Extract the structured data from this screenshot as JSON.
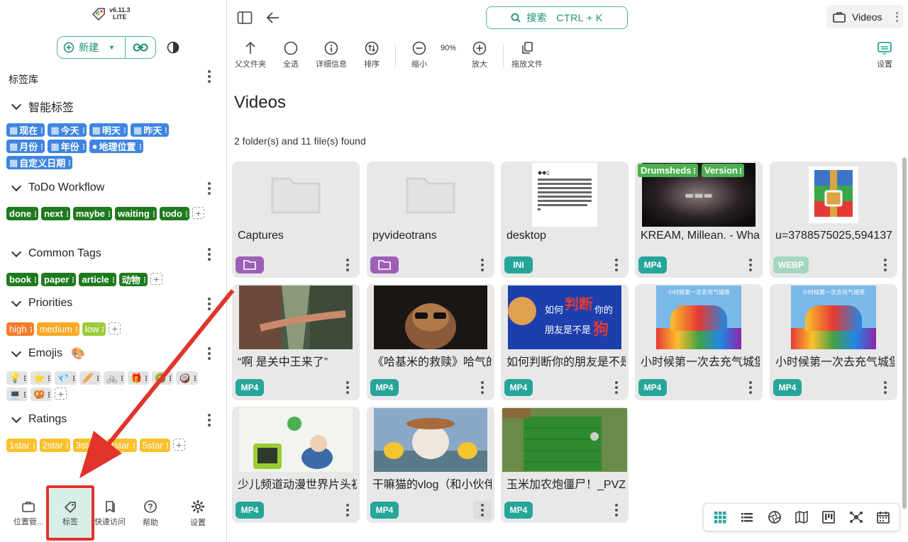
{
  "app": {
    "version": "v6.11.3",
    "edition": "LITE"
  },
  "sidebar": {
    "new_label": "新建",
    "library_title": "标签库",
    "groups": [
      {
        "title": "智能标签",
        "tags": [
          "现在",
          "今天",
          "明天",
          "昨天",
          "月份",
          "年份",
          "地理位置",
          "自定义日期"
        ]
      },
      {
        "title": "ToDo Workflow",
        "tags": [
          "done",
          "next",
          "maybe",
          "waiting",
          "todo"
        ]
      },
      {
        "title": "Common Tags",
        "tags": [
          "book",
          "paper",
          "article",
          "动物"
        ]
      },
      {
        "title": "Priorities",
        "tags": [
          "high",
          "medium",
          "low"
        ]
      },
      {
        "title": "Emojis",
        "emoji": "🎨",
        "tags": [
          "💡",
          "⭐",
          "💎",
          "🥖",
          "🚲",
          "🎁",
          "🥝",
          "🥥",
          "💻",
          "🥨"
        ]
      },
      {
        "title": "Ratings",
        "tags": [
          "1star",
          "2star",
          "3star",
          "4star",
          "5star"
        ]
      }
    ],
    "nav": [
      {
        "label": "位置管...",
        "icon": "briefcase-icon"
      },
      {
        "label": "标签",
        "icon": "tag-icon"
      },
      {
        "label": "快速访问",
        "icon": "bookmarks-icon"
      },
      {
        "label": "帮助",
        "icon": "help-icon"
      },
      {
        "label": "设置",
        "icon": "gear-icon"
      }
    ]
  },
  "header": {
    "search_label": "搜索   CTRL + K",
    "location": "Videos"
  },
  "toolbar": {
    "parent": "父文件夹",
    "select_all": "全选",
    "details": "详细信息",
    "sort": "排序",
    "zoom_out": "缩小",
    "zoom": "90%",
    "zoom_in": "放大",
    "drop": "拖放文件",
    "settings": "设置"
  },
  "main": {
    "title": "Videos",
    "count": "2 folder(s) and 11 file(s) found",
    "items": [
      {
        "name": "Captures",
        "ext": "",
        "type": "folder"
      },
      {
        "name": "pyvideotrans",
        "ext": "",
        "type": "folder"
      },
      {
        "name": "desktop",
        "ext": "INI",
        "type": "ini"
      },
      {
        "name": "KREAM, Millean. - What",
        "ext": "MP4",
        "type": "video",
        "tags": [
          "Drumsheds",
          "Version"
        ]
      },
      {
        "name": "u=3788575025,594137",
        "ext": "WEBP",
        "type": "webp"
      },
      {
        "name": "“啊 是关中王来了”",
        "ext": "MP4",
        "type": "video"
      },
      {
        "name": "《哈基米的救赎》哈气的",
        "ext": "MP4",
        "type": "video"
      },
      {
        "name": "如何判断你的朋友是不是",
        "ext": "MP4",
        "type": "video"
      },
      {
        "name": "小时候第一次去充气城堡",
        "ext": "MP4",
        "type": "video"
      },
      {
        "name": "小时候第一次去充气城堡",
        "ext": "MP4",
        "type": "video"
      },
      {
        "name": "少儿频道动漫世界片头初",
        "ext": "MP4",
        "type": "video"
      },
      {
        "name": "干嘛猫的vlog（和小伙伴",
        "ext": "MP4",
        "type": "video"
      },
      {
        "name": "玉米加农炮僵尸！_PVZ",
        "ext": "MP4",
        "type": "video"
      }
    ],
    "thumb_text": {
      "dog_q1": "如何",
      "dog_q2": "判断",
      "dog_q3": "你的",
      "dog_q4": "朋友是不是",
      "dog_q5": "狗",
      "castle": "小时候第一次去充气城堡"
    }
  },
  "colors": {
    "accent": "#1d8f74",
    "highlight": "#e0342c"
  }
}
